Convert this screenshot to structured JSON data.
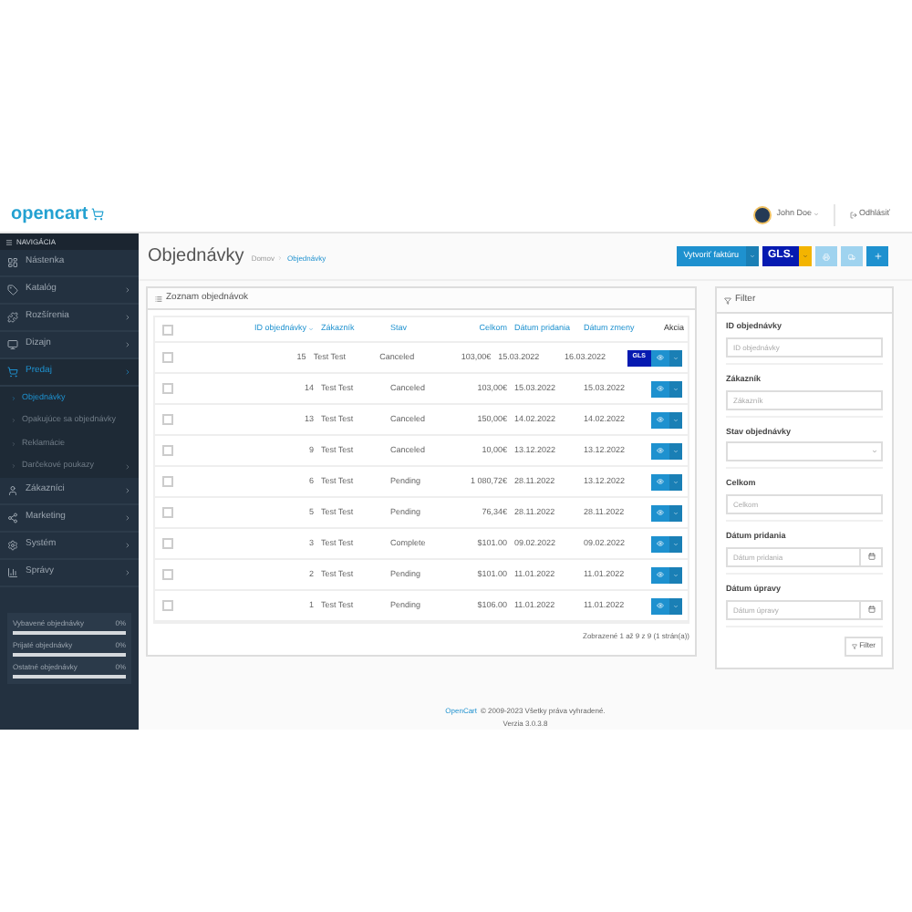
{
  "header": {
    "logo": "opencart",
    "user": "John Doe",
    "logout": "Odhlásiť"
  },
  "sidebar": {
    "title": "NAVIGÁCIA",
    "items": [
      {
        "label": "Nástenka",
        "expanded": false,
        "has_children": false
      },
      {
        "label": "Katalóg",
        "expanded": false,
        "has_children": true
      },
      {
        "label": "Rozšírenia",
        "expanded": false,
        "has_children": true
      },
      {
        "label": "Dizajn",
        "expanded": false,
        "has_children": true
      },
      {
        "label": "Predaj",
        "expanded": true,
        "has_children": true,
        "children": [
          {
            "label": "Objednávky",
            "selected": true,
            "has_children": false
          },
          {
            "label": "Opakujúce sa objednávky",
            "selected": false,
            "has_children": false
          },
          {
            "label": "Reklamácie",
            "selected": false,
            "has_children": false
          },
          {
            "label": "Darčekové poukazy",
            "selected": false,
            "has_children": true
          }
        ]
      },
      {
        "label": "Zákazníci",
        "expanded": false,
        "has_children": true
      },
      {
        "label": "Marketing",
        "expanded": false,
        "has_children": true
      },
      {
        "label": "Systém",
        "expanded": false,
        "has_children": true
      },
      {
        "label": "Správy",
        "expanded": false,
        "has_children": true
      }
    ],
    "stats": [
      {
        "label": "Vybavené objednávky",
        "value": "0%",
        "level": 0
      },
      {
        "label": "Prijaté objednávky",
        "value": "0%",
        "level": 0
      },
      {
        "label": "Ostatné objednávky",
        "value": "0%",
        "level": 0
      }
    ]
  },
  "page": {
    "title": "Objednávky",
    "breadcrumbs": [
      "Domov",
      "Objednávky"
    ]
  },
  "toolbar": {
    "invoice": "Vytvoriť faktúru",
    "gls": "GLS."
  },
  "list": {
    "title": "Zoznam objednávok",
    "columns": [
      {
        "label": "ID objednávky",
        "sortable": true,
        "sorted": true
      },
      {
        "label": "Zákazník",
        "sortable": true,
        "sorted": false
      },
      {
        "label": "Stav",
        "sortable": true,
        "sorted": false
      },
      {
        "label": "Celkom",
        "sortable": true,
        "sorted": false
      },
      {
        "label": "Dátum pridania",
        "sortable": true,
        "sorted": false
      },
      {
        "label": "Dátum zmeny",
        "sortable": true,
        "sorted": false
      },
      {
        "label": "Akcia",
        "sortable": false,
        "sorted": false
      }
    ],
    "header_checked": false,
    "rows": [
      {
        "cells": [
          "15",
          "Test Test",
          "Canceled",
          "103,00€",
          "15.03.2022",
          "16.03.2022"
        ],
        "checked": false,
        "label_button": "GLS"
      },
      {
        "cells": [
          "14",
          "Test Test",
          "Canceled",
          "103,00€",
          "15.03.2022",
          "15.03.2022"
        ],
        "checked": false
      },
      {
        "cells": [
          "13",
          "Test Test",
          "Canceled",
          "150,00€",
          "14.02.2022",
          "14.02.2022"
        ],
        "checked": false
      },
      {
        "cells": [
          "9",
          "Test Test",
          "Canceled",
          "10,00€",
          "13.12.2022",
          "13.12.2022"
        ],
        "checked": false
      },
      {
        "cells": [
          "6",
          "Test Test",
          "Pending",
          "1 080,72€",
          "28.11.2022",
          "13.12.2022"
        ],
        "checked": false
      },
      {
        "cells": [
          "5",
          "Test Test",
          "Pending",
          "76,34€",
          "28.11.2022",
          "28.11.2022"
        ],
        "checked": false
      },
      {
        "cells": [
          "3",
          "Test Test",
          "Complete",
          "$101.00",
          "09.02.2022",
          "09.02.2022"
        ],
        "checked": false
      },
      {
        "cells": [
          "2",
          "Test Test",
          "Pending",
          "$101.00",
          "11.01.2022",
          "11.01.2022"
        ],
        "checked": false
      },
      {
        "cells": [
          "1",
          "Test Test",
          "Pending",
          "$106.00",
          "11.01.2022",
          "11.01.2022"
        ],
        "checked": false
      }
    ],
    "pagination": "Zobrazené 1 až 9 z 9 (1 strán(a))"
  },
  "filter": {
    "title": "Filter",
    "fields": [
      {
        "label": "ID objednávky",
        "kind": "text",
        "placeholder": "ID objednávky"
      },
      {
        "label": "Zákazník",
        "kind": "text",
        "placeholder": "Zákazník"
      },
      {
        "label": "Stav objednávky",
        "kind": "select"
      },
      {
        "label": "Celkom",
        "kind": "text",
        "placeholder": "Celkom"
      },
      {
        "label": "Dátum pridania",
        "kind": "date",
        "placeholder": "Dátum pridania"
      },
      {
        "label": "Dátum úpravy",
        "kind": "date",
        "placeholder": "Dátum úpravy"
      }
    ],
    "button": "Filter"
  },
  "footer": {
    "link": "OpenCart",
    "copyright": "© 2009-2023 Všetky práva vyhradené.",
    "version": "Verzia 3.0.3.8"
  }
}
